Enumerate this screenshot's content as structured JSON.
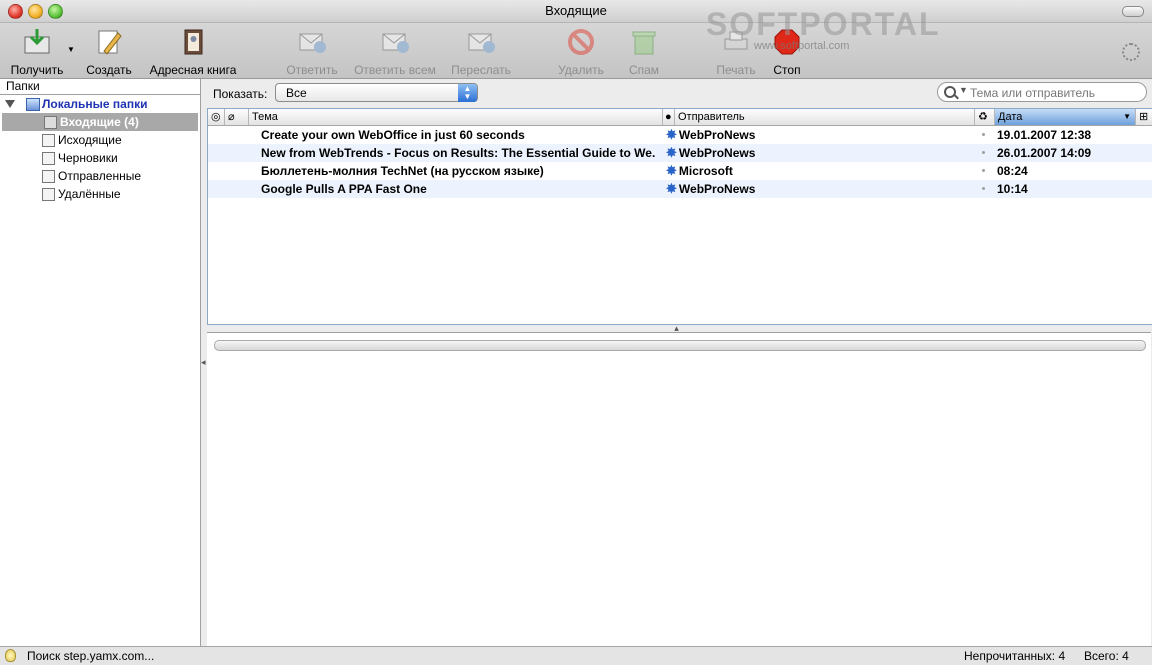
{
  "window": {
    "title": "Входящие"
  },
  "watermark": {
    "brand": "SOFTPORTAL",
    "url": "www.softportal.com"
  },
  "toolbar": {
    "buttons": [
      {
        "label": "Получить",
        "icon": "get-mail-icon",
        "enabled": true
      },
      {
        "label": "Создать",
        "icon": "compose-icon",
        "enabled": true
      },
      {
        "label": "Адресная книга",
        "icon": "address-book-icon",
        "enabled": true
      },
      {
        "label": "Ответить",
        "icon": "reply-icon",
        "enabled": false
      },
      {
        "label": "Ответить всем",
        "icon": "reply-all-icon",
        "enabled": false
      },
      {
        "label": "Переслать",
        "icon": "forward-icon",
        "enabled": false
      },
      {
        "label": "Удалить",
        "icon": "delete-icon",
        "enabled": false
      },
      {
        "label": "Спам",
        "icon": "junk-icon",
        "enabled": false
      },
      {
        "label": "Печать",
        "icon": "print-icon",
        "enabled": false
      },
      {
        "label": "Стоп",
        "icon": "stop-icon",
        "enabled": true
      }
    ]
  },
  "sidebar": {
    "header": "Папки",
    "root": "Локальные папки",
    "folders": [
      {
        "label": "Входящие (4)",
        "icon": "inbox-icon",
        "selected": true
      },
      {
        "label": "Исходящие",
        "icon": "outbox-icon"
      },
      {
        "label": "Черновики",
        "icon": "drafts-icon"
      },
      {
        "label": "Отправленные",
        "icon": "sent-icon"
      },
      {
        "label": "Удалённые",
        "icon": "trash-icon"
      }
    ]
  },
  "filter": {
    "label": "Показать:",
    "value": "Все"
  },
  "search": {
    "placeholder": "Тема или отправитель"
  },
  "columns": {
    "subject": "Тема",
    "sender": "Отправитель",
    "date": "Дата"
  },
  "messages": [
    {
      "subject": "Create your own WebOffice in just 60 seconds",
      "sender": "WebProNews",
      "date": "19.01.2007 12:38"
    },
    {
      "subject": "New from WebTrends - Focus on Results: The Essential Guide to We...",
      "sender": "WebProNews",
      "date": "26.01.2007 14:09"
    },
    {
      "subject": "Бюллетень-молния TechNet (на русском языке)",
      "sender": "Microsoft",
      "date": "08:24"
    },
    {
      "subject": "Google Pulls A PPA Fast One",
      "sender": "WebProNews",
      "date": "10:14"
    }
  ],
  "status": {
    "text": "Поиск step.yamx.com...",
    "unread": "Непрочитанных: 4",
    "total": "Всего: 4"
  },
  "colors": {
    "accent": "#1f33b3",
    "selection": "#a8a8a8",
    "unread_star": "#2a64c8"
  }
}
